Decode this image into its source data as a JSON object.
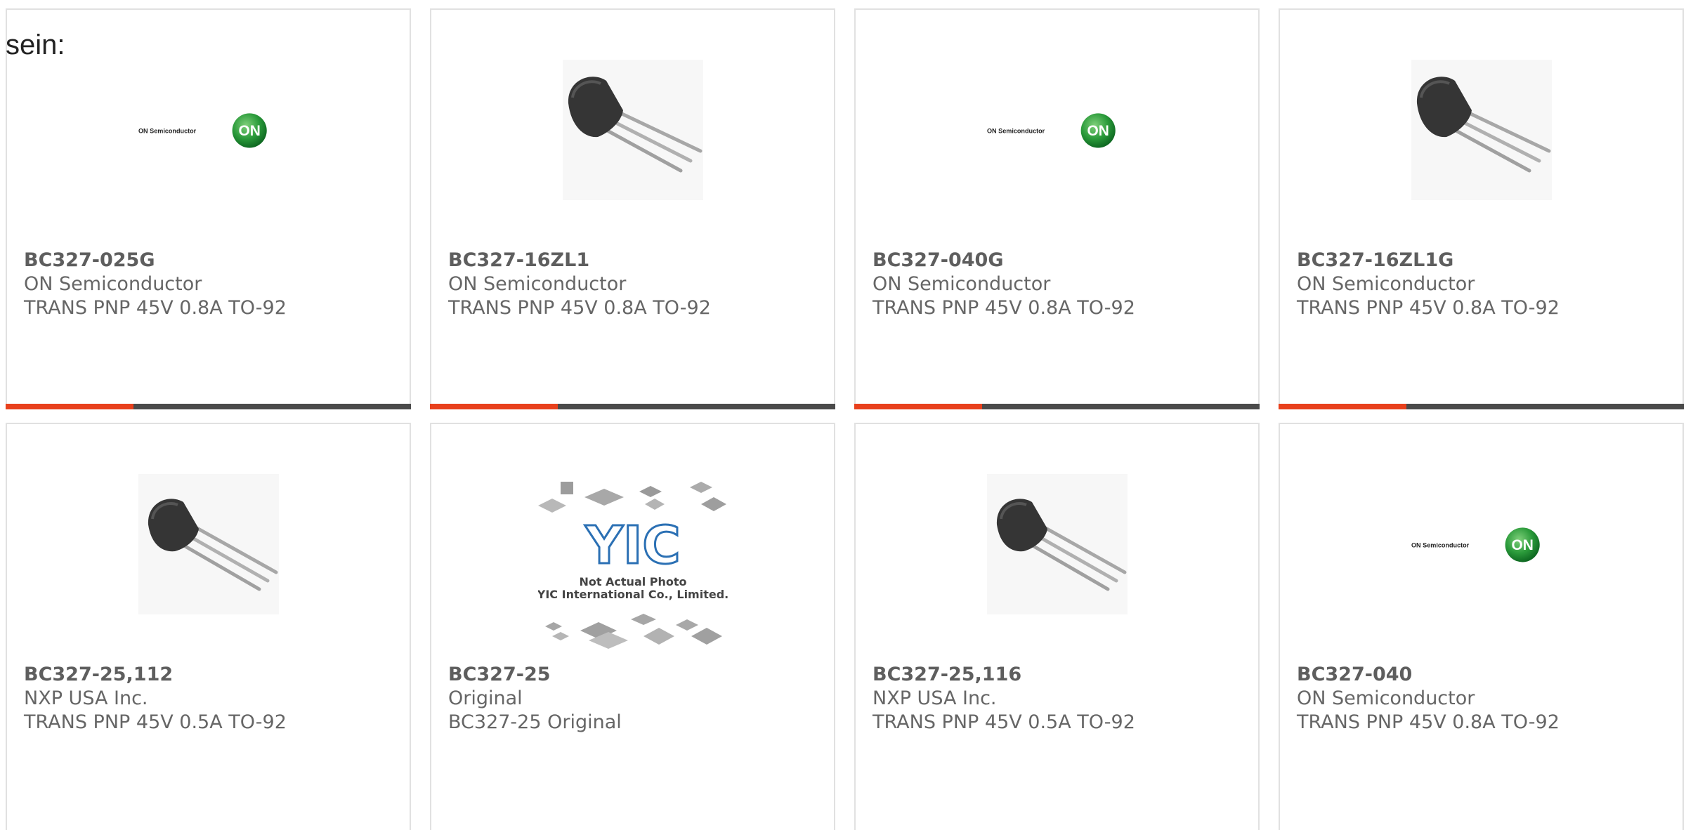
{
  "intro_text": "sein:",
  "accent_color": "#e8401c",
  "bar_color": "#4a4a4a",
  "products": [
    {
      "part_number": "BC327-025G",
      "manufacturer": "ON Semiconductor",
      "description": "TRANS PNP 45V 0.8A TO-92",
      "image": "on-semiconductor-logo",
      "logo_text": "ON Semiconductor",
      "logo_mark": "ON"
    },
    {
      "part_number": "BC327-16ZL1",
      "manufacturer": "ON Semiconductor",
      "description": "TRANS PNP 45V 0.8A TO-92",
      "image": "transistor-to92-photo"
    },
    {
      "part_number": "BC327-040G",
      "manufacturer": "ON Semiconductor",
      "description": "TRANS PNP 45V 0.8A TO-92",
      "image": "on-semiconductor-logo",
      "logo_text": "ON Semiconductor",
      "logo_mark": "ON"
    },
    {
      "part_number": "BC327-16ZL1G",
      "manufacturer": "ON Semiconductor",
      "description": "TRANS PNP 45V 0.8A TO-92",
      "image": "transistor-to92-photo"
    },
    {
      "part_number": "BC327-25,112",
      "manufacturer": "NXP USA Inc.",
      "description": "TRANS PNP 45V 0.5A TO-92",
      "image": "transistor-to92-photo"
    },
    {
      "part_number": "BC327-25",
      "manufacturer": "Original",
      "description": "BC327-25 Original",
      "image": "yic-placeholder",
      "placeholder_brand": "YIC",
      "placeholder_line1": "Not Actual Photo",
      "placeholder_line2": "YIC International Co., Limited."
    },
    {
      "part_number": "BC327-25,116",
      "manufacturer": "NXP USA Inc.",
      "description": "TRANS PNP 45V 0.5A TO-92",
      "image": "transistor-to92-photo"
    },
    {
      "part_number": "BC327-040",
      "manufacturer": "ON Semiconductor",
      "description": "TRANS PNP 45V 0.8A TO-92",
      "image": "on-semiconductor-logo",
      "logo_text": "ON Semiconductor",
      "logo_mark": "ON"
    }
  ]
}
